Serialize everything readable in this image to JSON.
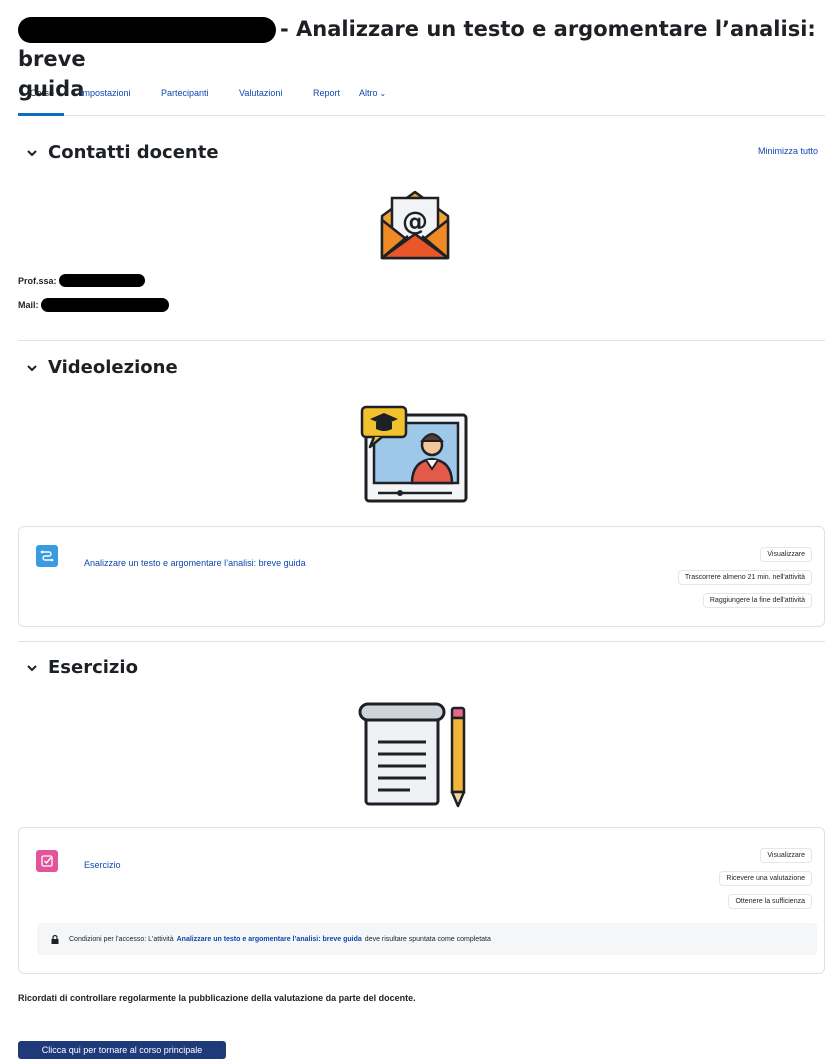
{
  "header": {
    "title_line1": "- Analizzare un testo e argomentare l’analisi: breve",
    "title_line2": "guida"
  },
  "nav": {
    "tabs": [
      {
        "label": "Corso"
      },
      {
        "label": "Impostazioni"
      },
      {
        "label": "Partecipanti"
      },
      {
        "label": "Valutazioni"
      },
      {
        "label": "Report"
      },
      {
        "label": "Altro"
      }
    ]
  },
  "minimize_label": "Minimizza tutto",
  "sections": {
    "contatti": {
      "title": "Contatti docente",
      "prof_label": "Prof.ssa:",
      "mail_label": "Mail:",
      "image_icon": "email-envelope-icon"
    },
    "videolezione": {
      "title": "Videolezione",
      "image_icon": "video-lesson-icon",
      "activity": {
        "title": "Analizzare un testo e argomentare l’analisi: breve guida",
        "icon": "lesson-icon",
        "conditions": [
          "Visualizzare",
          "Trascorrere almeno 21 min. nell'attività",
          "Raggiungere la fine dell'attività"
        ]
      }
    },
    "esercizio": {
      "title": "Esercizio",
      "image_icon": "notepad-pencil-icon",
      "activity": {
        "title": "Esercizio",
        "icon": "assignment-icon",
        "conditions": [
          "Visualizzare",
          "Ricevere una valutazione",
          "Ottenere la sufficienza"
        ],
        "restriction": {
          "prefix": "Condizioni per l'accesso: L'attività",
          "link": "Analizzare un testo e argomentare l’analisi: breve guida",
          "suffix": "deve risultare spuntata come completata"
        }
      }
    }
  },
  "footer": {
    "reminder": "Ricordati di controllare regolarmente la pubblicazione della valutazione da parte del docente.",
    "back_button": "Clicca qui per tornare al corso principale"
  },
  "colors": {
    "link": "#0f47ad",
    "lesson_icon_bg": "#399be2",
    "assignment_icon_bg": "#e4549b",
    "back_button_bg": "#1e3a7a"
  }
}
